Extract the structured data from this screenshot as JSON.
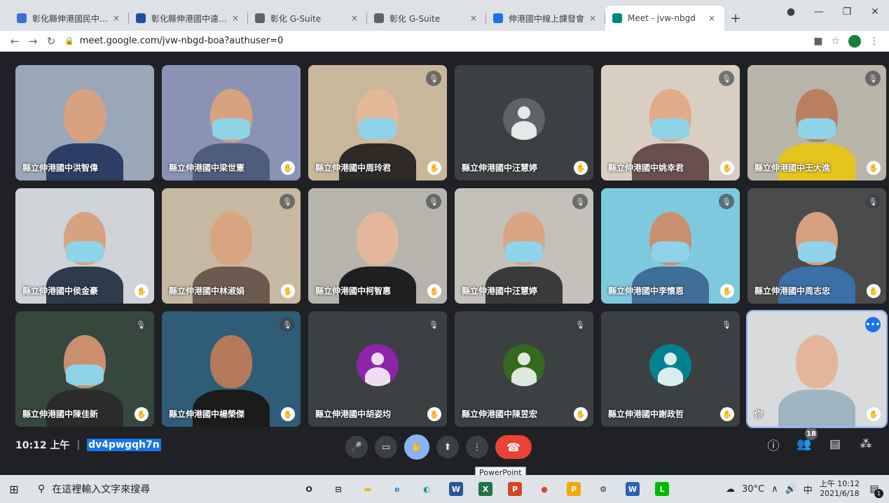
{
  "browser": {
    "tabs": [
      {
        "title": "彰化縣伸港國民中學 -",
        "favicon_color": "#3b6fd4",
        "active": false
      },
      {
        "title": "彰化縣伸港國中遠距教",
        "favicon_color": "#1f4ea3",
        "active": false
      },
      {
        "title": "彰化 G-Suite",
        "favicon_color": "#5f6368",
        "active": false
      },
      {
        "title": "彰化 G-Suite",
        "favicon_color": "#5f6368",
        "active": false
      },
      {
        "title": "伸港國中線上課發會",
        "favicon_color": "#1a73e8",
        "active": false
      },
      {
        "title": "Meet - jvw-nbgd",
        "favicon_color": "#00897b",
        "active": true
      }
    ],
    "tab_close_glyph": "×",
    "new_tab_glyph": "+",
    "url": "meet.google.com/jvw-nbgd-boa?authuser=0"
  },
  "meet": {
    "participants": [
      {
        "name": "縣立伸港國中洪智偉",
        "video": "person",
        "bg": "#9aa7b8",
        "skin": "#d9a27e",
        "shirt": "#2c3e66",
        "masked": false,
        "muted": false,
        "hand": false
      },
      {
        "name": "縣立伸港國中梁世憲",
        "video": "person",
        "bg": "#8b93b5",
        "skin": "#d9a27e",
        "shirt": "#4e5d7d",
        "masked": true,
        "muted": false,
        "hand": true
      },
      {
        "name": "縣立伸港國中周玲君",
        "video": "person",
        "bg": "#c9b79a",
        "skin": "#e3b899",
        "shirt": "#2e2a28",
        "masked": true,
        "muted": true,
        "hand": true
      },
      {
        "name": "縣立伸港國中汪慧婷",
        "video": "avatar",
        "avatar_color": "#5f6368",
        "muted": false,
        "hand": true
      },
      {
        "name": "縣立伸港國中姚幸君",
        "video": "person",
        "bg": "#d8cfc2",
        "skin": "#e0ac8c",
        "shirt": "#6a4f4f",
        "masked": true,
        "muted": true,
        "hand": true
      },
      {
        "name": "縣立伸港國中王大進",
        "video": "person",
        "bg": "#b9b4a8",
        "skin": "#b88061",
        "shirt": "#e5c51c",
        "masked": true,
        "muted": true,
        "hand": true
      },
      {
        "name": "縣立伸港國中侯金豪",
        "video": "person",
        "bg": "#cfd2d6",
        "skin": "#d6a381",
        "shirt": "#2f3b4c",
        "masked": true,
        "muted": false,
        "hand": true
      },
      {
        "name": "縣立伸港國中林淑娟",
        "video": "person",
        "bg": "#c7b8a1",
        "skin": "#d9a482",
        "shirt": "#6b5a4d",
        "masked": false,
        "muted": true,
        "hand": true
      },
      {
        "name": "縣立伸港國中柯智惠",
        "video": "person",
        "bg": "#b7b4ae",
        "skin": "#e3b69a",
        "shirt": "#1f1f22",
        "masked": false,
        "muted": true,
        "hand": true
      },
      {
        "name": "縣立伸港國中汪慧婷",
        "video": "person",
        "bg": "#c4c1bb",
        "skin": "#d9a482",
        "shirt": "#3a3a3a",
        "masked": true,
        "muted": true,
        "hand": false
      },
      {
        "name": "縣立伸港國中李懷恩",
        "video": "person",
        "bg": "#7fc9de",
        "skin": "#c98f6e",
        "shirt": "#3f6e99",
        "masked": true,
        "muted": true,
        "hand": true
      },
      {
        "name": "縣立伸港國中周志忠",
        "video": "person",
        "bg": "#4b4b4b",
        "skin": "#d6a07e",
        "shirt": "#3a6fa8",
        "masked": true,
        "muted": true,
        "hand": true
      },
      {
        "name": "縣立伸港國中陳佳新",
        "video": "person",
        "bg": "#36473d",
        "skin": "#c98f6e",
        "shirt": "#2b2b2b",
        "masked": true,
        "muted": true,
        "hand": true
      },
      {
        "name": "縣立伸港國中楊榮傑",
        "video": "person",
        "bg": "#2f5d78",
        "skin": "#b47a5a",
        "shirt": "#1b1b1b",
        "masked": false,
        "muted": true,
        "hand": true
      },
      {
        "name": "縣立伸港國中胡姿均",
        "video": "avatar",
        "avatar_color": "#8e24aa",
        "muted": true,
        "hand": true
      },
      {
        "name": "縣立伸港國中陳昱宏",
        "video": "avatar",
        "avatar_color": "#33691e",
        "muted": true,
        "hand": true
      },
      {
        "name": "縣立伸港國中謝政哲",
        "video": "avatar",
        "avatar_color": "#00838f",
        "muted": true,
        "hand": true
      },
      {
        "name": "你",
        "video": "person",
        "bg": "#d8dadc",
        "skin": "#e3b69a",
        "shirt": "#9fb5c4",
        "masked": false,
        "muted": false,
        "hand": true,
        "self": true
      }
    ],
    "hand_glyph": "✋",
    "mic_off_glyph": "🎙",
    "more_glyph": "•••",
    "time": "10:12 上午",
    "divider": "|",
    "meeting_code": "dv4pwgqh7n",
    "tooltip": "PowerPoint",
    "people_count": "18"
  },
  "taskbar": {
    "search_placeholder": "在這裡輸入文字來搜尋",
    "apps": [
      {
        "label": "O",
        "color": "#202124",
        "bg": "transparent"
      },
      {
        "label": "⊟",
        "color": "#202124",
        "bg": "transparent"
      },
      {
        "label": "▬",
        "color": "#f4b400",
        "bg": "transparent"
      },
      {
        "label": "e",
        "color": "#1e88e5",
        "bg": "transparent"
      },
      {
        "label": "◐",
        "color": "#0f9d8f",
        "bg": "transparent"
      },
      {
        "label": "W",
        "color": "#ffffff",
        "bg": "#2b579a"
      },
      {
        "label": "X",
        "color": "#ffffff",
        "bg": "#217346"
      },
      {
        "label": "P",
        "color": "#ffffff",
        "bg": "#d24726"
      },
      {
        "label": "●",
        "color": "#db4437",
        "bg": "transparent"
      },
      {
        "label": "P",
        "color": "#ffffff",
        "bg": "#f2a900"
      },
      {
        "label": "⚙",
        "color": "#202124",
        "bg": "transparent"
      },
      {
        "label": "W",
        "color": "#ffffff",
        "bg": "#2a62b8"
      },
      {
        "label": "L",
        "color": "#ffffff",
        "bg": "#00b900"
      }
    ],
    "weather": "30°C",
    "ime": "中",
    "clock_time": "上午 10:12",
    "clock_date": "2021/6/18",
    "notification_count": "1"
  }
}
